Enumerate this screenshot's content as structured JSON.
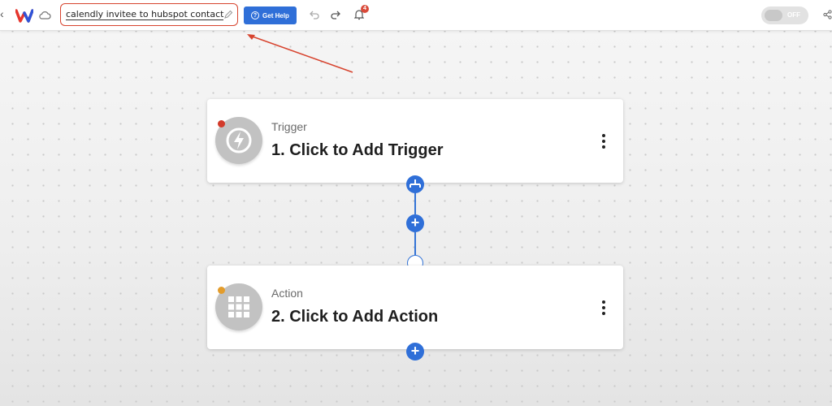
{
  "toolbar": {
    "workflow_name": "calendly invitee to hubspot contact",
    "help_label": "Get Help",
    "notification_count": "4",
    "toggle_label": "OFF",
    "brand_color": "#2f6fd8",
    "highlight_color": "#d7442f",
    "icons": [
      "back-icon",
      "logo-icon",
      "cloud-icon",
      "pencil-icon",
      "help-icon",
      "undo-icon",
      "redo-icon",
      "bell-icon",
      "share-icon"
    ]
  },
  "steps": [
    {
      "kicker": "Trigger",
      "title": "1. Click to Add Trigger",
      "status_color": "#d23a2a",
      "icon": "lightning-icon"
    },
    {
      "kicker": "Action",
      "title": "2. Click to Add Action",
      "status_color": "#e39c2b",
      "icon": "apps-grid-icon"
    }
  ],
  "connectors": {
    "add_symbol": "+"
  }
}
